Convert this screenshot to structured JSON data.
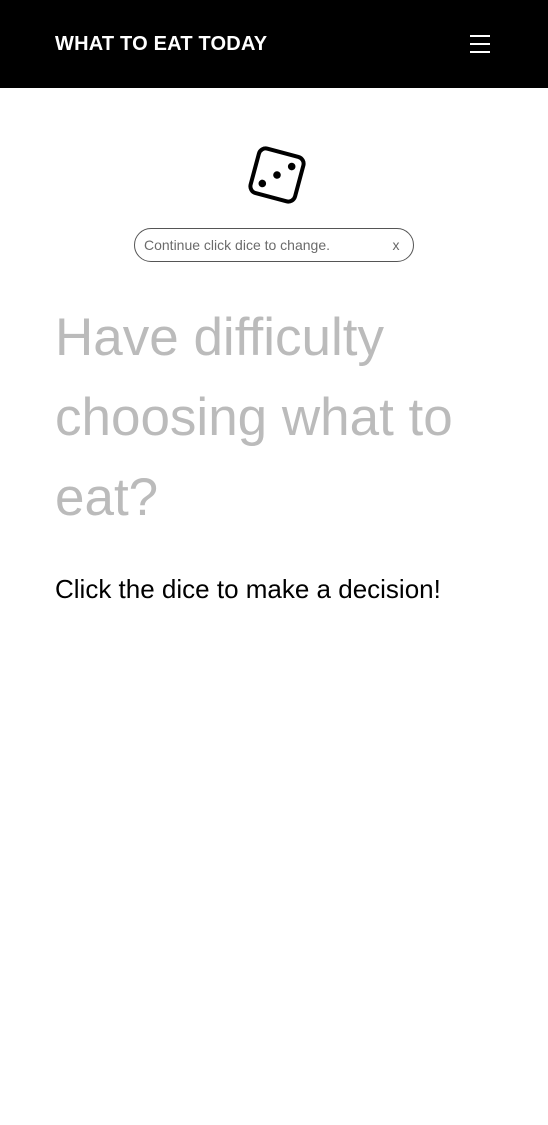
{
  "header": {
    "brand": "WHAT TO EAT TODAY",
    "menu_icon": "hamburger-menu-icon",
    "background": "#000000",
    "text_color": "#ffffff"
  },
  "dice": {
    "icon": "dice-three-icon"
  },
  "hint": {
    "text": "Continue click dice to change.",
    "close_label": "x"
  },
  "main": {
    "headline": "Have difficulty choosing what to eat?",
    "subline": "Click the dice to make a decision!",
    "headline_color": "#bbbbbb",
    "subline_color": "#000000"
  }
}
